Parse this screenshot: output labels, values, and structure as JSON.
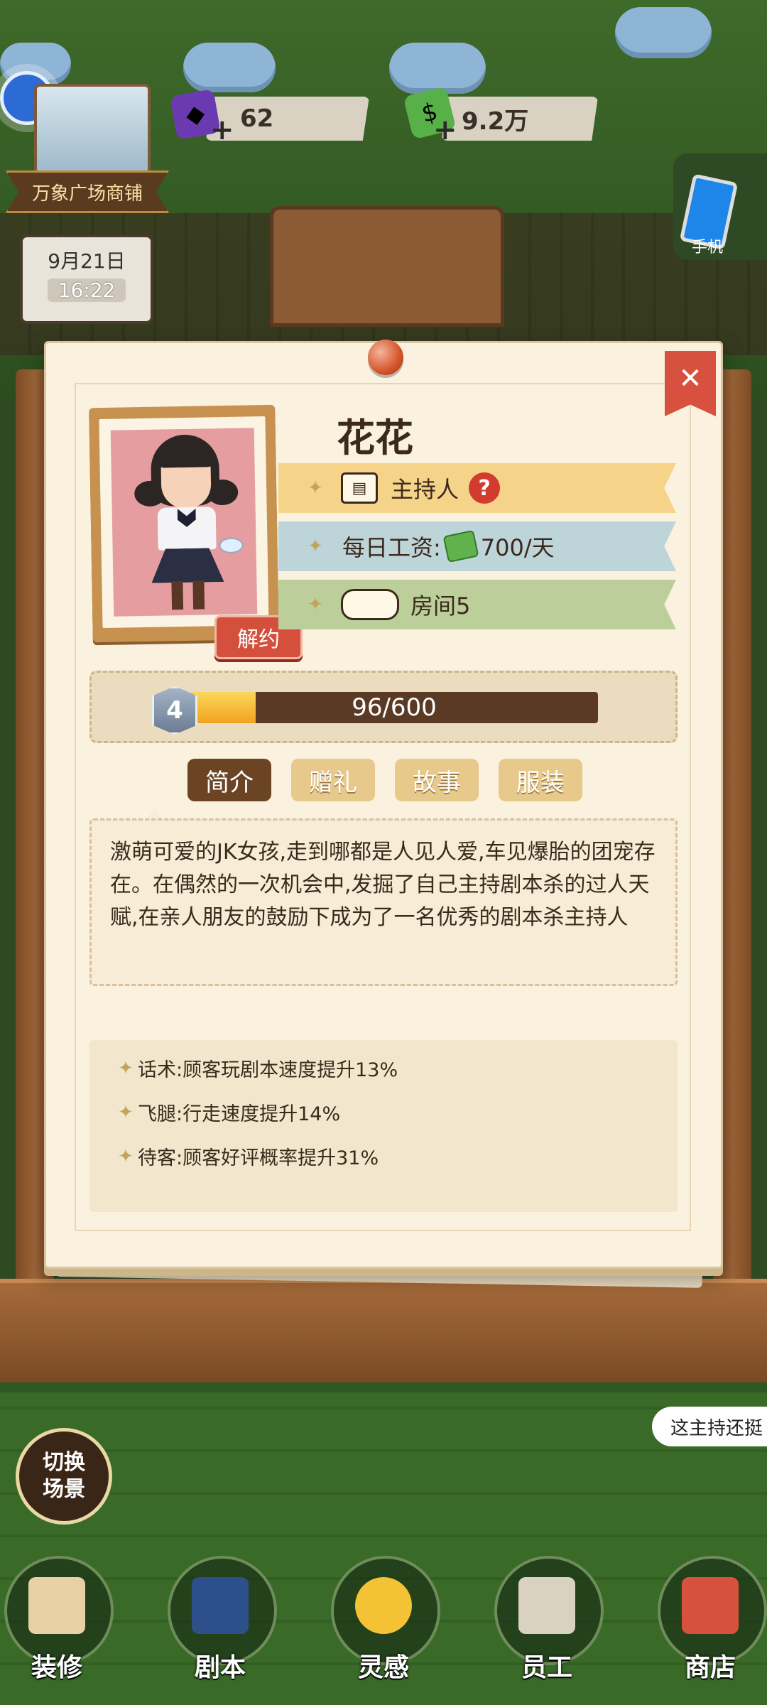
{
  "hud": {
    "gems": "62",
    "cash": "9.2万",
    "shop_sign": "万象广场商铺",
    "date": "9月21日",
    "time": "16:22",
    "phone_label": "手机"
  },
  "card": {
    "name": "花花",
    "role": "主持人",
    "role_help": "?",
    "salary_label": "每日工资:",
    "salary_value": "700/天",
    "room": "房间5",
    "terminate_label": "解约",
    "close": "✕",
    "level": "4",
    "xp_text": "96/600",
    "xp_progress": 0.16,
    "tabs": [
      "简介",
      "赠礼",
      "故事",
      "服装"
    ],
    "active_tab": "简介",
    "intro": "激萌可爱的JK女孩,走到哪都是人见人爱,车见爆胎的团宠存在。在偶然的一次机会中,发掘了自己主持剧本杀的过人天赋,在亲人朋友的鼓励下成为了一名优秀的剧本杀主持人",
    "skills": [
      "话术:顾客玩剧本速度提升13%",
      "飞腿:行走速度提升14%",
      "待客:顾客好评概率提升31%"
    ]
  },
  "bottom": {
    "switch_scene": "切换\n场景",
    "speech": "这主持还挺",
    "nav": [
      "装修",
      "剧本",
      "灵感",
      "员工",
      "商店"
    ]
  },
  "colors": {
    "accent_red": "#d4503d",
    "card_bg": "#faf1de",
    "tab_active": "#6b4424",
    "tab_inactive": "#e6c98b"
  }
}
